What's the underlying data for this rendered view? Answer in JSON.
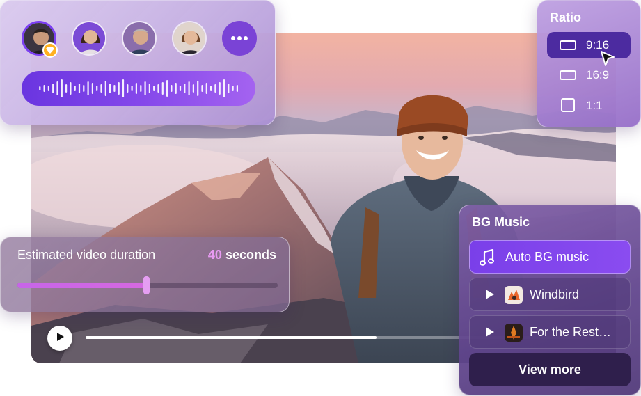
{
  "avatars": {
    "items": [
      {
        "name": "presenter-1",
        "selected": true
      },
      {
        "name": "presenter-2",
        "selected": false
      },
      {
        "name": "presenter-3",
        "selected": false
      },
      {
        "name": "presenter-4",
        "selected": false
      }
    ],
    "more_icon": "ellipsis-icon",
    "badge_icon": "sketch-gem-icon"
  },
  "voice": {
    "icon": "audio-waveform-icon"
  },
  "ratio": {
    "title": "Ratio",
    "options": [
      {
        "label": "9:16",
        "selected": true
      },
      {
        "label": "16:9",
        "selected": false
      },
      {
        "label": "1:1",
        "selected": false
      }
    ]
  },
  "duration": {
    "label": "Estimated video duration",
    "value": "40",
    "unit": "seconds",
    "slider_level": 0.495
  },
  "video": {
    "progress": 0.58,
    "play_icon": "play-icon"
  },
  "music": {
    "title": "BG Music",
    "items": [
      {
        "label": "Auto BG music",
        "icon": "music-note-icon",
        "selected": true
      },
      {
        "label": "Windbird",
        "icon": "play-icon",
        "selected": false
      },
      {
        "label": "For the Rest…",
        "icon": "play-icon",
        "selected": false
      }
    ],
    "view_more": "View more"
  },
  "colors": {
    "accent": "#7b3ff2",
    "duration_value": "#e79af1",
    "slider_fill": "#c765e8",
    "view_more_bg": "#2f1f4c"
  }
}
